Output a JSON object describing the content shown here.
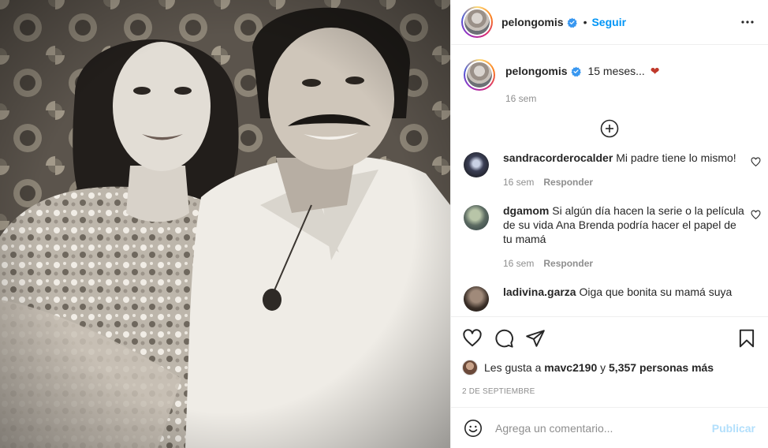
{
  "post": {
    "username": "pelongomis",
    "follow_label": "Seguir",
    "dot": "•",
    "more_icon": "more-horizontal-icon"
  },
  "caption": {
    "username": "pelongomis",
    "text": "15 meses...",
    "emoji": "❤",
    "time": "16 sem"
  },
  "comments": [
    {
      "username": "sandracorderocalder",
      "text": "Mi padre tiene lo mismo!",
      "time": "16 sem",
      "reply_label": "Responder"
    },
    {
      "username": "dgamom",
      "text": "Si algún día hacen la serie o la película de su vida Ana Brenda podría hacer el papel de tu mamá",
      "time": "16 sem",
      "reply_label": "Responder"
    },
    {
      "username": "ladivina.garza",
      "text": "Oiga que bonita su mamá suya",
      "time": "",
      "reply_label": ""
    }
  ],
  "likes": {
    "prefix": "Les gusta a",
    "user": "mavc2190",
    "connector": "y",
    "others": "5,357 personas más"
  },
  "date": "2 de septiembre",
  "composer": {
    "placeholder": "Agrega un comentario...",
    "post_label": "Publicar"
  },
  "colors": {
    "accent": "#0095f6",
    "post_disabled": "#b2dffc",
    "heart_red": "#c0392b",
    "muted": "#8e8e8e"
  }
}
